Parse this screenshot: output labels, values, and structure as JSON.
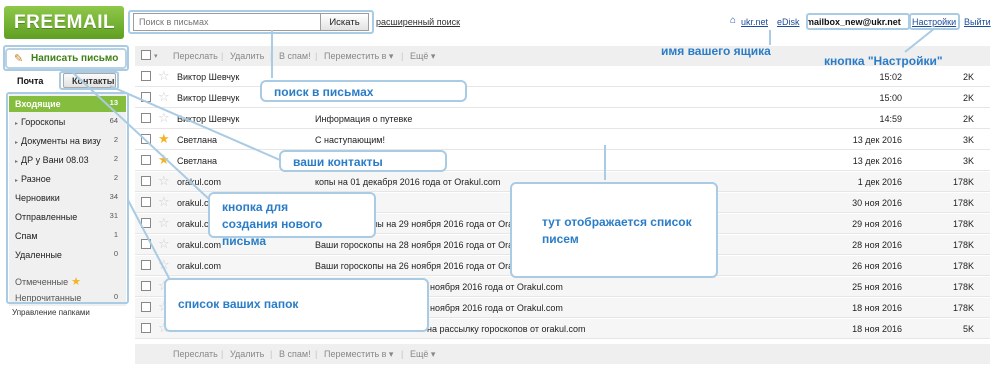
{
  "brand": {
    "logo": "FREEMAIL"
  },
  "search": {
    "placeholder": "Поиск в письмах",
    "button_label": "Искать",
    "advanced_link": "расширенный поиск"
  },
  "header": {
    "ukr_link": "ukr.net",
    "edisk_link": "eDisk",
    "mailbox": "mailbox_new@ukr.net",
    "settings_link": "Настройки",
    "exit_link": "Выйти"
  },
  "compose": {
    "label": "Написать письмо"
  },
  "tabs": {
    "mail": "Почта",
    "contacts": "Контакты"
  },
  "folders": [
    {
      "label": "Входящие",
      "count": "13",
      "active": true
    },
    {
      "label": "Гороскопы",
      "count": "64",
      "sub": true
    },
    {
      "label": "Документы на визу",
      "count": "2",
      "sub": true
    },
    {
      "label": "ДР у Вани 08.03",
      "count": "2",
      "sub": true
    },
    {
      "label": "Разное",
      "count": "2",
      "sub": true
    },
    {
      "label": "Черновики",
      "count": "34"
    },
    {
      "label": "Отправленные",
      "count": "31"
    },
    {
      "label": "Спам",
      "count": "1"
    },
    {
      "label": "Удаленные",
      "count": "0"
    },
    {
      "label": "Отмеченные",
      "count": ""
    },
    {
      "label": "Непрочитанные",
      "count": "0"
    }
  ],
  "manage_folders": "Управление папками",
  "toolbar": {
    "forward": "Переслать",
    "delete": "Удалить",
    "spam": "В спам!",
    "move": "Переместить в ▾",
    "more": "Ещё ▾"
  },
  "messages": [
    {
      "from": "Виктор Шевчук",
      "subject": "",
      "date": "15:02",
      "size": "2K",
      "starred": false
    },
    {
      "from": "Виктор Шевчук",
      "subject": "",
      "date": "15:00",
      "size": "2K",
      "starred": false
    },
    {
      "from": "Виктор Шевчук",
      "subject": "Информация о путевке",
      "date": "14:59",
      "size": "2K",
      "starred": false
    },
    {
      "from": "Светлана",
      "subject": "С наступающим!",
      "date": "13 дек 2016",
      "size": "3K",
      "starred": true
    },
    {
      "from": "Светлана",
      "subject": "",
      "date": "13 дек 2016",
      "size": "3K",
      "starred": true
    },
    {
      "from": "orakul.com",
      "subject": "копы на 01 декабря 2016 года от Orakul.com",
      "date": "1 дек 2016",
      "size": "178K",
      "starred": false
    },
    {
      "from": "orakul.com",
      "subject": "",
      "date": "30 ноя 2016",
      "size": "178K",
      "starred": false
    },
    {
      "from": "orakul.com",
      "subject": "Ваши гороскопы на 29 ноября 2016 года от Orakul.com",
      "date": "29 ноя 2016",
      "size": "178K",
      "starred": false
    },
    {
      "from": "orakul.com",
      "subject": "Ваши гороскопы на 28 ноября 2016 года от Orakul.com",
      "date": "28 ноя 2016",
      "size": "178K",
      "starred": false
    },
    {
      "from": "orakul.com",
      "subject": "Ваши гороскопы на 26 ноября 2016 года от Orakul.com",
      "date": "26 ноя 2016",
      "size": "178K",
      "starred": false
    },
    {
      "from": "",
      "subject": "ноября 2016 года от Orakul.com",
      "date": "25 ноя 2016",
      "size": "178K",
      "starred": false
    },
    {
      "from": "",
      "subject": "ноября 2016 года от Orakul.com",
      "date": "18 ноя 2016",
      "size": "178K",
      "starred": false
    },
    {
      "from": "",
      "subject": "на рассылку гороскопов от orakul.com",
      "date": "18 ноя 2016",
      "size": "5K",
      "starred": false
    }
  ],
  "annotations": {
    "mailbox_name": "имя вашего ящика",
    "settings_button": "кнопка \"Настройки\"",
    "search_in_mail": "поиск в письмах",
    "your_contacts": "ваши контакты",
    "compose_button": "кнопка для создания нового письма",
    "letters_list": "тут отображается список писем",
    "folders_list": "список ваших папок"
  },
  "colors": {
    "brand_green": "#6fb02f",
    "active_folder": "#85bd3e",
    "callout_text": "#2a7cc7",
    "callout_border": "#a9cbe3",
    "star": "#f3b322"
  }
}
